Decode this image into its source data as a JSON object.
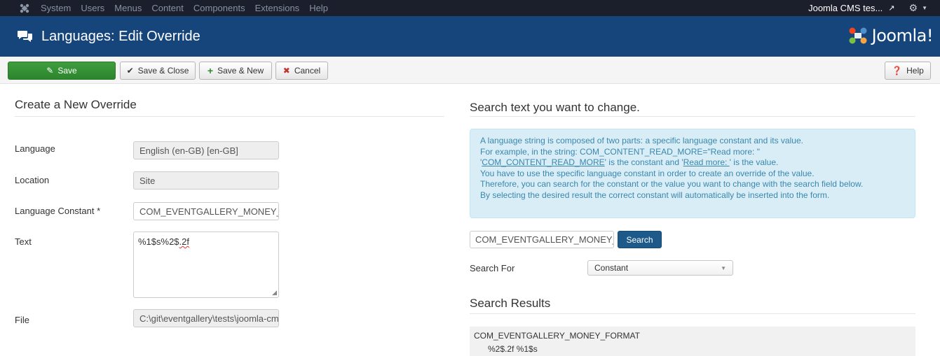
{
  "topbar": {
    "menu": [
      "System",
      "Users",
      "Menus",
      "Content",
      "Components",
      "Extensions",
      "Help"
    ],
    "site_link": "Joomla CMS tes..."
  },
  "header": {
    "title": "Languages: Edit Override",
    "brand": "Joomla!"
  },
  "toolbar": {
    "save": "Save",
    "save_close": "Save & Close",
    "save_new": "Save & New",
    "cancel": "Cancel",
    "help": "Help"
  },
  "form": {
    "heading": "Create a New Override",
    "language_label": "Language",
    "language_value": "English (en-GB) [en-GB]",
    "location_label": "Location",
    "location_value": "Site",
    "constant_label": "Language Constant *",
    "constant_value": "COM_EVENTGALLERY_MONEY_FORMAT",
    "text_label": "Text",
    "text_value_a": "%1$s%2$",
    "text_value_b": ".2f",
    "file_label": "File",
    "file_value": "C:\\git\\eventgallery\\tests\\joomla-cms\\language\\overrides\\en-GB.override.ini"
  },
  "search": {
    "heading": "Search text you want to change.",
    "info": {
      "line1": "A language string is composed of two parts: a specific language constant and its value.",
      "line2": "For example, in the string: COM_CONTENT_READ_MORE=\"Read more: \"",
      "line3_link1": "COM_CONTENT_READ_MORE",
      "line3_mid": "' is the constant and '",
      "line3_link2": "Read more: ",
      "line3_end": "' is the value.",
      "line4": "You have to use the specific language constant in order to create an override of the value.",
      "line5": "Therefore, you can search for the constant or the value you want to change with the search field below.",
      "line6": "By selecting the desired result the correct constant will automatically be inserted into the form."
    },
    "input_value": "COM_EVENTGALLERY_MONEY_FORMAT",
    "button": "Search",
    "search_for_label": "Search For",
    "search_for_value": "Constant",
    "results_heading": "Search Results",
    "results": [
      {
        "constant": "COM_EVENTGALLERY_MONEY_FORMAT",
        "value": "%2$.2f %1$s"
      }
    ]
  }
}
